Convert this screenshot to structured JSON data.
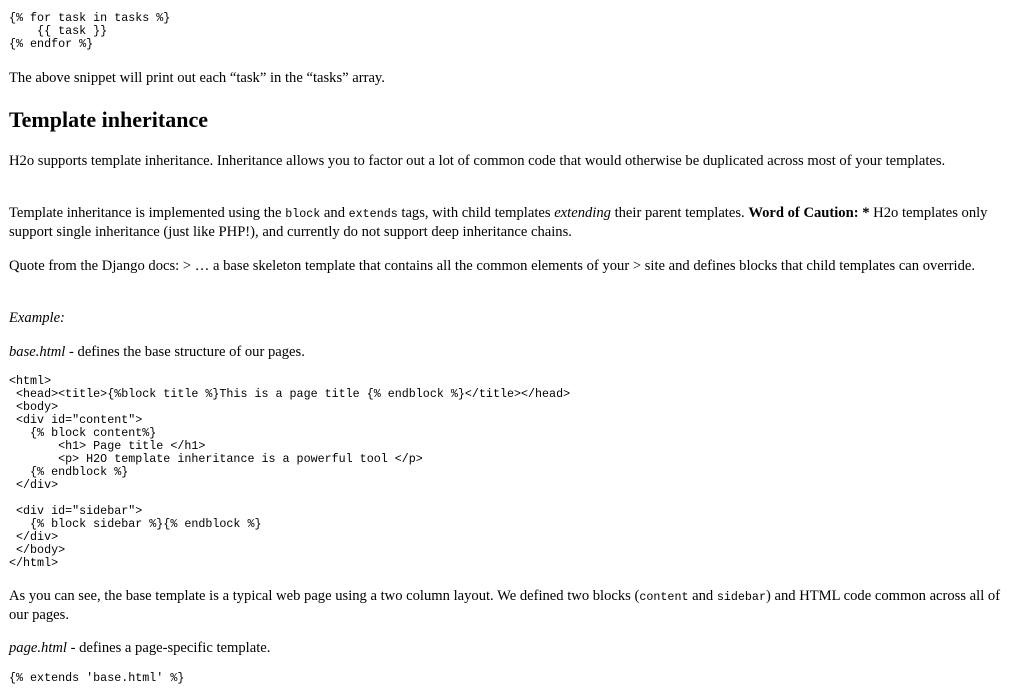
{
  "code_loop": "{% for task in tasks %}\n    {{ task }}\n{% endfor %}",
  "p_loop": "The above snippet will print out each “task” in the “tasks” array.",
  "heading": "Template inheritance",
  "p_intro": "H2o supports template inheritance. Inheritance allows you to factor out a lot of common code that would otherwise be duplicated across most of your templates.",
  "p_impl": {
    "t1": "Template inheritance is implemented using the ",
    "c1": "block",
    "t2": " and ",
    "c2": "extends",
    "t3": " tags, with child templates ",
    "em1": "extending",
    "t4": " their parent templates. ",
    "strong1": "Word of Caution: *",
    "t5": " H2o templates only support single inheritance (just like PHP!), and currently do not support deep inheritance chains."
  },
  "p_quote": "Quote from the Django docs: > … a base skeleton template that contains all the common elements of your > site and defines blocks that child templates can override.",
  "p_example": "Example:",
  "p_base": {
    "em": "base.html",
    "rest": " - defines the base structure of our pages."
  },
  "code_base": "<html>\n <head><title>{%block title %}This is a page title {% endblock %}</title></head>\n <body>\n <div id=\"content\">\n   {% block content%}\n       <h1> Page title </h1>\n       <p> H2O template inheritance is a powerful tool </p>\n   {% endblock %}\n </div>\n\n <div id=\"sidebar\">\n   {% block sidebar %}{% endblock %}\n </div>\n </body>\n</html>",
  "p_asyousee": {
    "t1": "As you can see, the base template is a typical web page using a two column layout. We defined two blocks (",
    "c1": "content",
    "t2": " and ",
    "c2": "sidebar",
    "t3": ") and HTML code common across all of our pages."
  },
  "p_page": {
    "em": "page.html",
    "rest": " - defines a page-specific template."
  },
  "code_extends": "{% extends 'base.html' %}"
}
